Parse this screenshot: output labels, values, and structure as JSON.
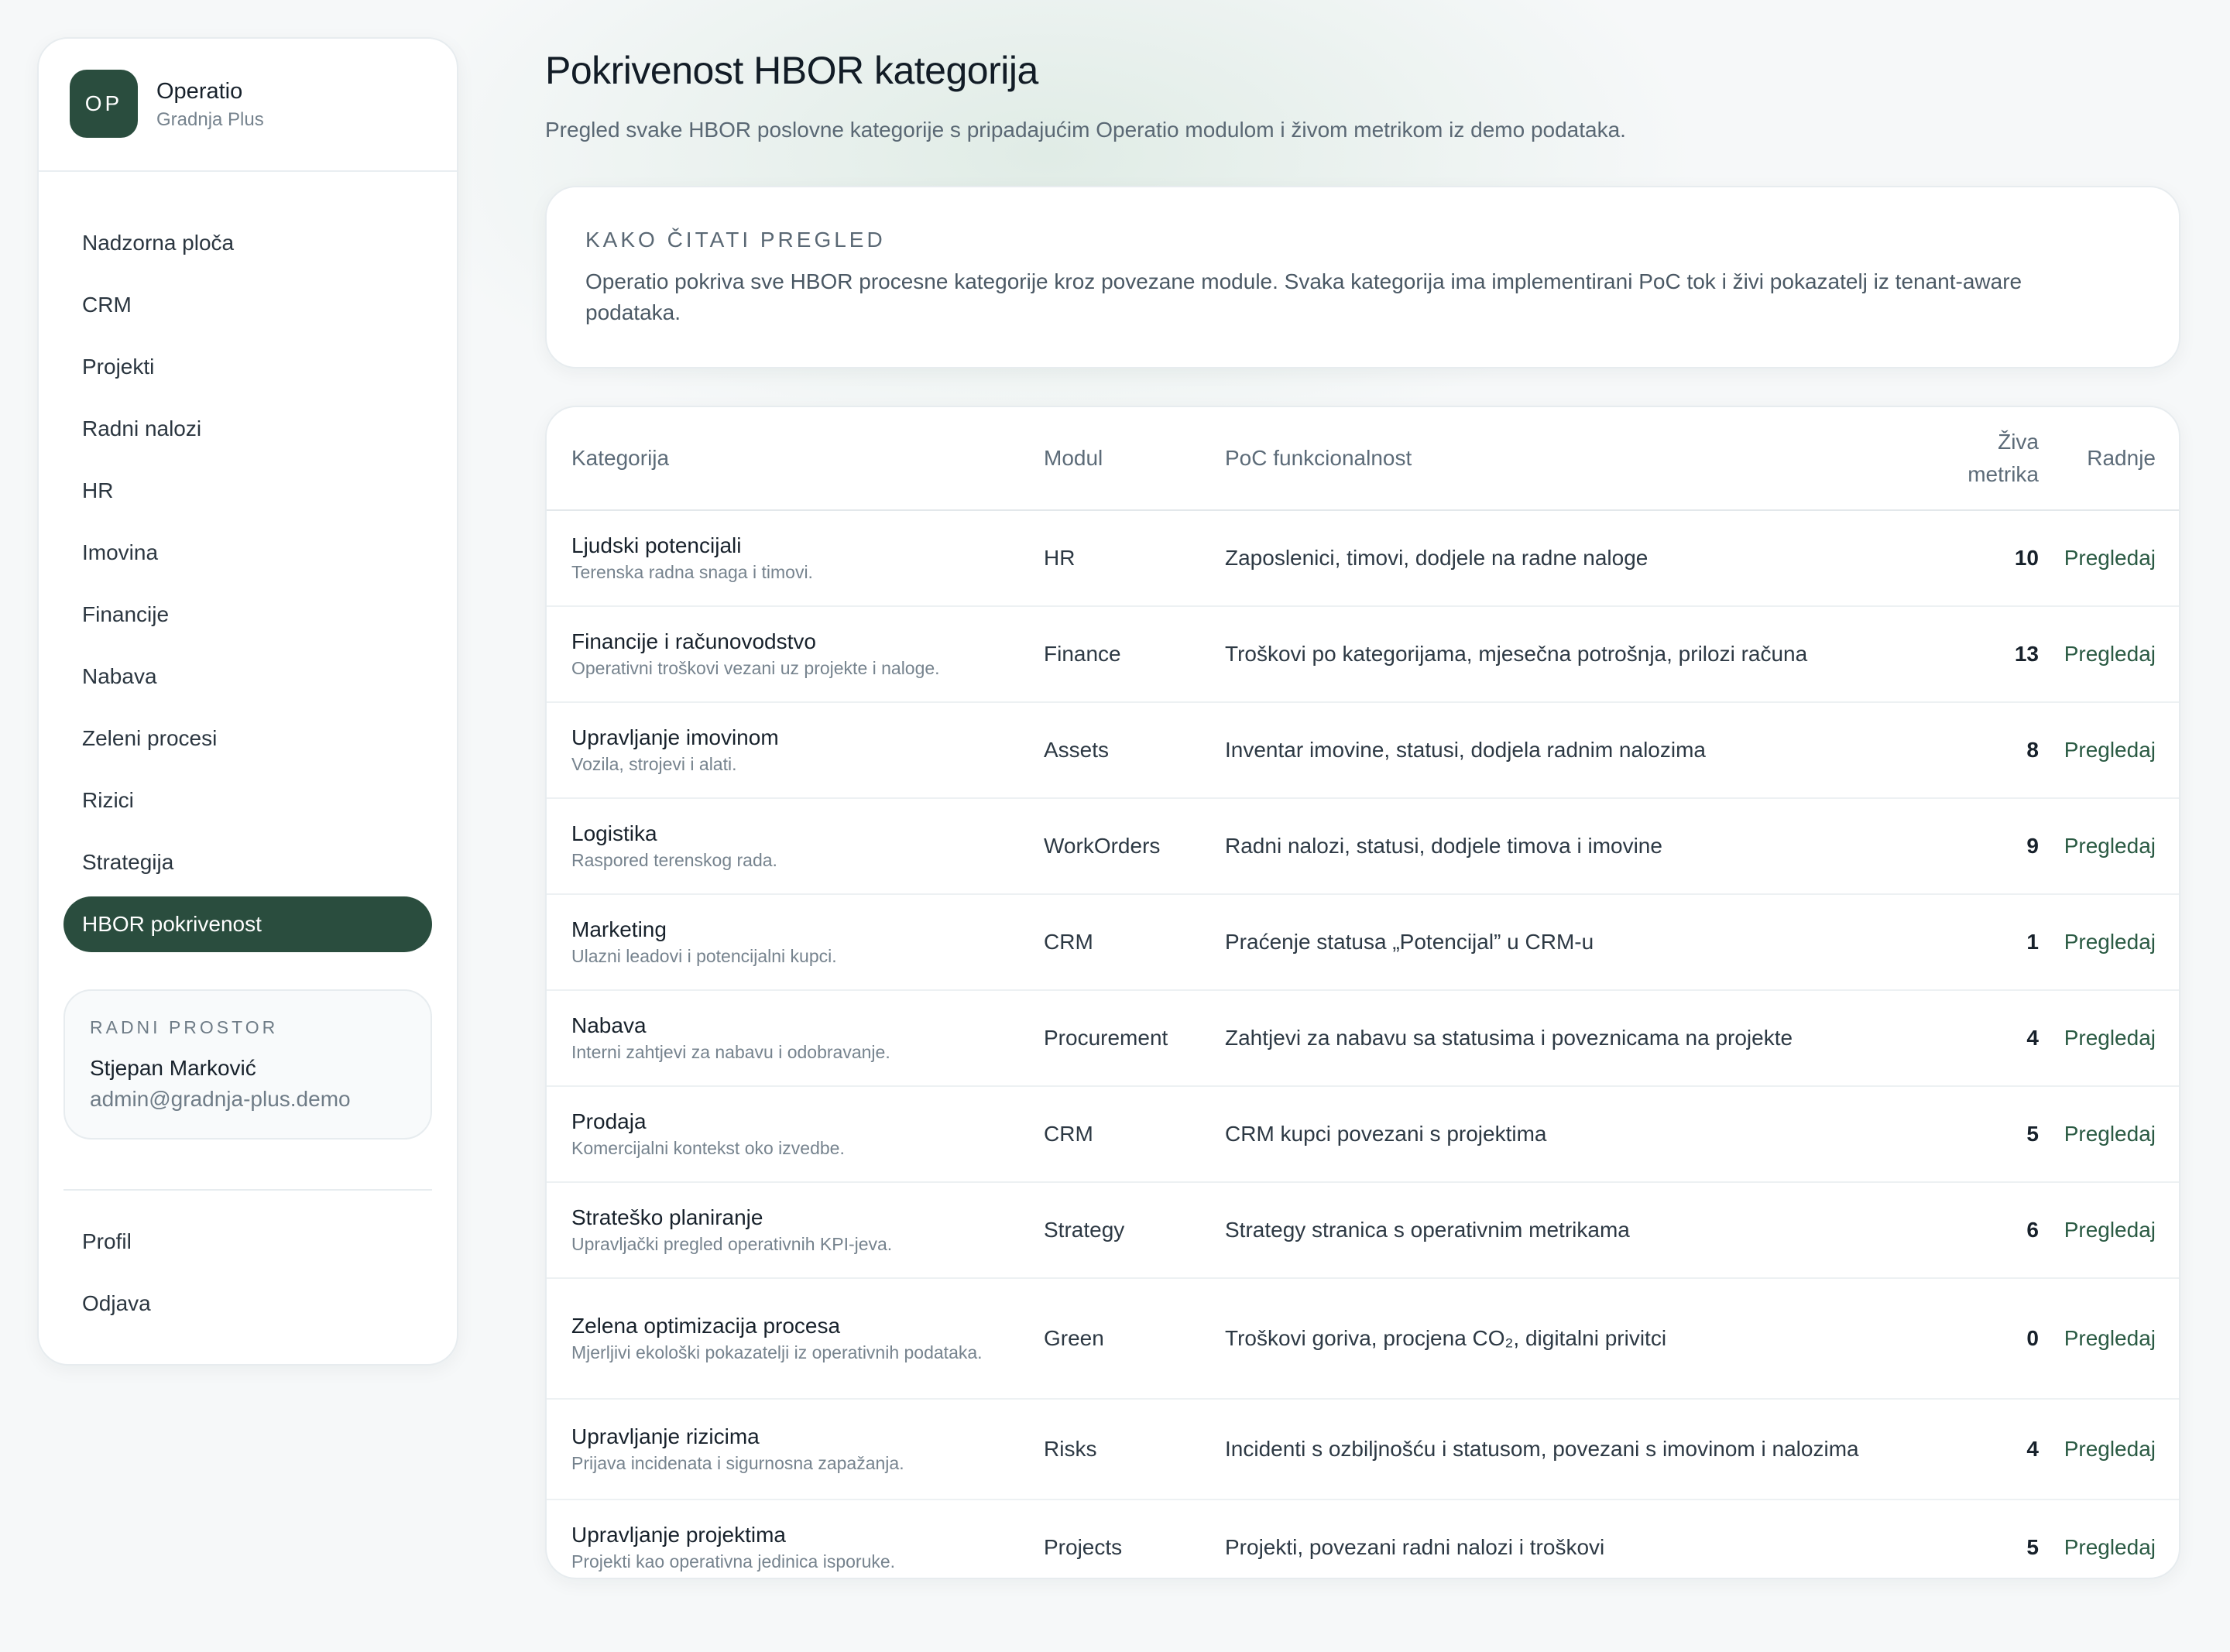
{
  "sidebar": {
    "brand": {
      "initials": "OP",
      "name": "Operatio",
      "company": "Gradnja Plus"
    },
    "nav": [
      {
        "label": "Nadzorna ploča",
        "active": false
      },
      {
        "label": "CRM",
        "active": false
      },
      {
        "label": "Projekti",
        "active": false
      },
      {
        "label": "Radni nalozi",
        "active": false
      },
      {
        "label": "HR",
        "active": false
      },
      {
        "label": "Imovina",
        "active": false
      },
      {
        "label": "Financije",
        "active": false
      },
      {
        "label": "Nabava",
        "active": false
      },
      {
        "label": "Zeleni procesi",
        "active": false
      },
      {
        "label": "Rizici",
        "active": false
      },
      {
        "label": "Strategija",
        "active": false
      },
      {
        "label": "HBOR pokrivenost",
        "active": true
      }
    ],
    "workspace": {
      "label": "RADNI PROSTOR",
      "user": "Stjepan Marković",
      "email": "admin@gradnja-plus.demo"
    },
    "bottom": [
      {
        "label": "Profil"
      },
      {
        "label": "Odjava"
      }
    ]
  },
  "main": {
    "title": "Pokrivenost HBOR kategorija",
    "subtitle": "Pregled svake HBOR poslovne kategorije s pripadajućim Operatio modulom i živom metrikom iz demo podataka.",
    "info": {
      "title": "KAKO ČITATI PREGLED",
      "text": "Operatio pokriva sve HBOR procesne kategorije kroz povezane module. Svaka kategorija ima implementirani PoC tok i živi pokazatelj iz tenant-aware podataka."
    },
    "table": {
      "headers": {
        "category": "Kategorija",
        "module": "Modul",
        "poc": "PoC funkcionalnost",
        "metric_line1": "Živa",
        "metric_line2": "metrika",
        "actions": "Radnje"
      },
      "rows": [
        {
          "title": "Ljudski potencijali",
          "desc": "Terenska radna snaga i timovi.",
          "module": "HR",
          "poc": "Zaposlenici, timovi, dodjele na radne naloge",
          "metric": "10",
          "action": "Pregledaj"
        },
        {
          "title": "Financije i računovodstvo",
          "desc": "Operativni troškovi vezani uz projekte i naloge.",
          "module": "Finance",
          "poc": "Troškovi po kategorijama, mjesečna potrošnja, prilozi računa",
          "metric": "13",
          "action": "Pregledaj"
        },
        {
          "title": "Upravljanje imovinom",
          "desc": "Vozila, strojevi i alati.",
          "module": "Assets",
          "poc": "Inventar imovine, statusi, dodjela radnim nalozima",
          "metric": "8",
          "action": "Pregledaj"
        },
        {
          "title": "Logistika",
          "desc": "Raspored terenskog rada.",
          "module": "WorkOrders",
          "poc": "Radni nalozi, statusi, dodjele timova i imovine",
          "metric": "9",
          "action": "Pregledaj"
        },
        {
          "title": "Marketing",
          "desc": "Ulazni leadovi i potencijalni kupci.",
          "module": "CRM",
          "poc": "Praćenje statusa „Potencijal” u CRM-u",
          "metric": "1",
          "action": "Pregledaj"
        },
        {
          "title": "Nabava",
          "desc": "Interni zahtjevi za nabavu i odobravanje.",
          "module": "Procurement",
          "poc": "Zahtjevi za nabavu sa statusima i poveznicama na projekte",
          "metric": "4",
          "action": "Pregledaj"
        },
        {
          "title": "Prodaja",
          "desc": "Komercijalni kontekst oko izvedbe.",
          "module": "CRM",
          "poc": "CRM kupci povezani s projektima",
          "metric": "5",
          "action": "Pregledaj"
        },
        {
          "title": "Strateško planiranje",
          "desc": "Upravljački pregled operativnih KPI-jeva.",
          "module": "Strategy",
          "poc": "Strategy stranica s operativnim metrikama",
          "metric": "6",
          "action": "Pregledaj"
        },
        {
          "title": "Zelena optimizacija procesa",
          "desc": "Mjerljivi ekološki pokazatelji iz operativnih podataka.",
          "module": "Green",
          "poc": "Troškovi goriva, procjena CO₂, digitalni privitci",
          "metric": "0",
          "action": "Pregledaj"
        },
        {
          "title": "Upravljanje rizicima",
          "desc": "Prijava incidenata i sigurnosna zapažanja.",
          "module": "Risks",
          "poc": "Incidenti s ozbiljnošću i statusom, povezani s imovinom i nalozima",
          "metric": "4",
          "action": "Pregledaj"
        },
        {
          "title": "Upravljanje projektima",
          "desc": "Projekti kao operativna jedinica isporuke.",
          "module": "Projects",
          "poc": "Projekti, povezani radni nalozi i troškovi",
          "metric": "5",
          "action": "Pregledaj"
        }
      ]
    }
  }
}
